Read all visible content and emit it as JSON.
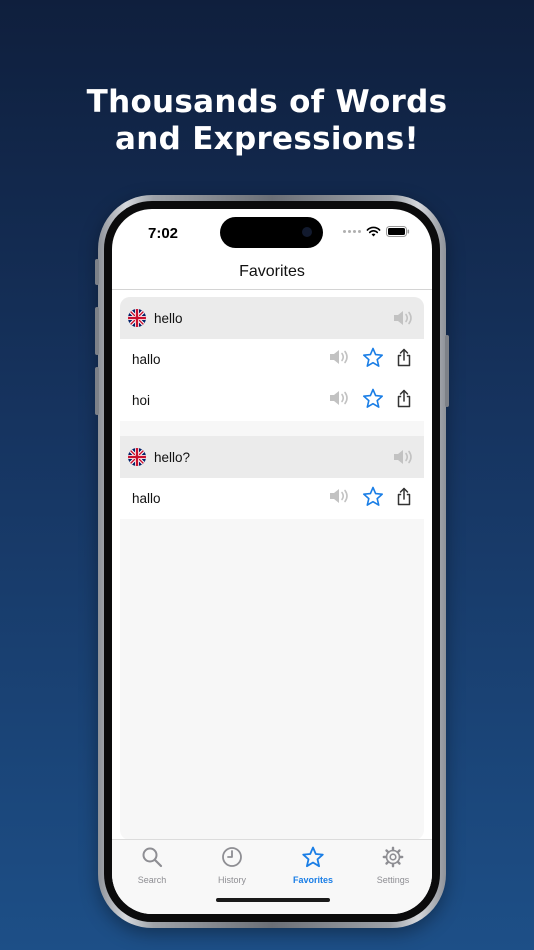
{
  "headline": {
    "line1": "Thousands of Words",
    "line2": "and Expressions!"
  },
  "status_bar": {
    "time": "7:02"
  },
  "nav": {
    "title": "Favorites"
  },
  "favorites": [
    {
      "word": "hello",
      "language_flag": "uk-flag-icon",
      "translations": [
        {
          "text": "hallo",
          "favorited": true
        },
        {
          "text": "hoi",
          "favorited": true
        }
      ]
    },
    {
      "word": "hello?",
      "language_flag": "uk-flag-icon",
      "translations": [
        {
          "text": "hallo",
          "favorited": true
        }
      ]
    }
  ],
  "tabs": [
    {
      "label": "Search",
      "icon": "search-icon",
      "active": false
    },
    {
      "label": "History",
      "icon": "clock-icon",
      "active": false
    },
    {
      "label": "Favorites",
      "icon": "star-icon",
      "active": true
    },
    {
      "label": "Settings",
      "icon": "gear-icon",
      "active": false
    }
  ],
  "colors": {
    "accent": "#1a7ee6",
    "inactive_tab": "#8e8e93",
    "header_row": "#ebebeb"
  }
}
